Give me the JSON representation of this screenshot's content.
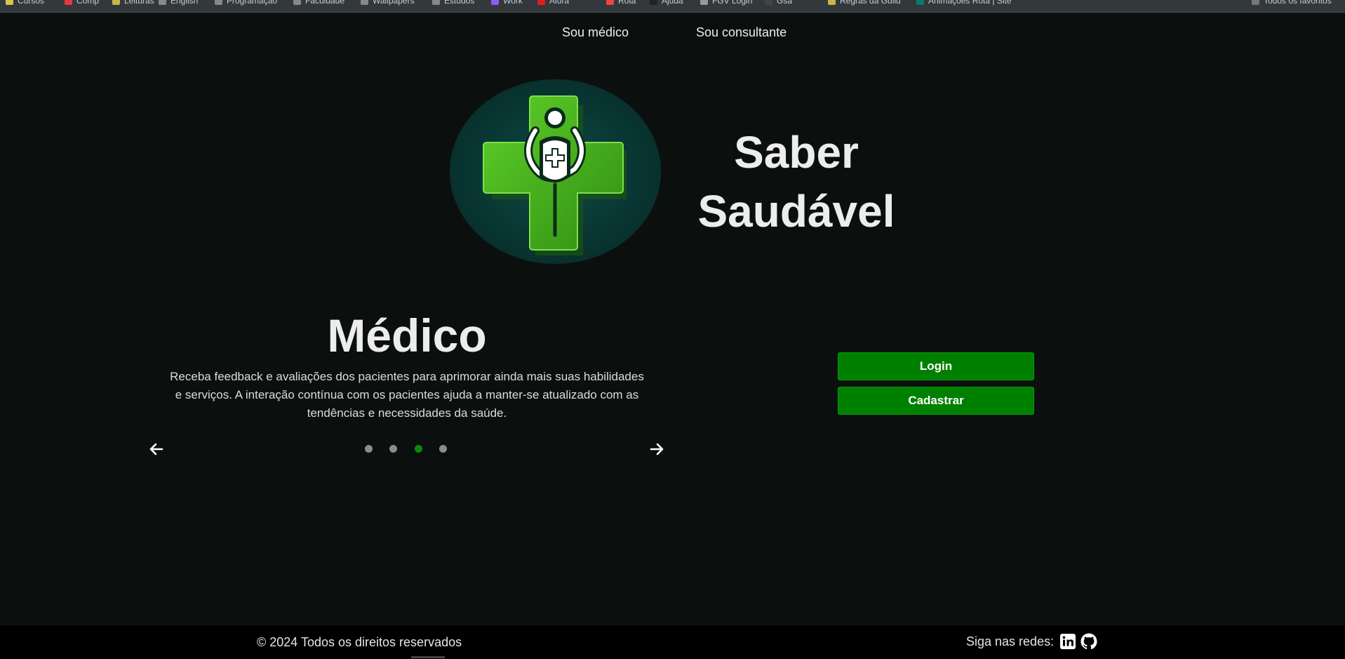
{
  "bookmarks": [
    "Cursos",
    "Comp",
    "Leituras",
    "English",
    "Programação",
    "Faculdade",
    "Wallpapers",
    "Estudos",
    "Work",
    "Alura",
    "Rota",
    "Ajuda",
    "FGV Login",
    "Gsa",
    "Regras da Guild",
    "Animações Rota | Site"
  ],
  "bookmarks_right": "Todos os favoritos",
  "nav": {
    "doctor": "Sou médico",
    "consultant": "Sou consultante"
  },
  "brand": {
    "line1": "Saber",
    "line2": "Saudável"
  },
  "slide": {
    "title": "Médico",
    "text": "Receba feedback e avaliações dos pacientes para aprimorar ainda mais suas habilidades e serviços. A interação contínua com os pacientes ajuda a manter-se atualizado com as tendências e necessidades da saúde.",
    "active_index": 2,
    "count": 4
  },
  "actions": {
    "login": "Login",
    "register": "Cadastrar"
  },
  "footer": {
    "copyright": "© 2024 Todos os direitos reservados",
    "social_label": "Siga nas redes:",
    "icons": [
      "linkedin-icon",
      "github-icon"
    ]
  },
  "colors": {
    "background": "#0b100e",
    "button": "#008000",
    "active_dot": "#0a8a0a",
    "inactive_dot": "#8a8d8b",
    "footer": "#000000"
  }
}
